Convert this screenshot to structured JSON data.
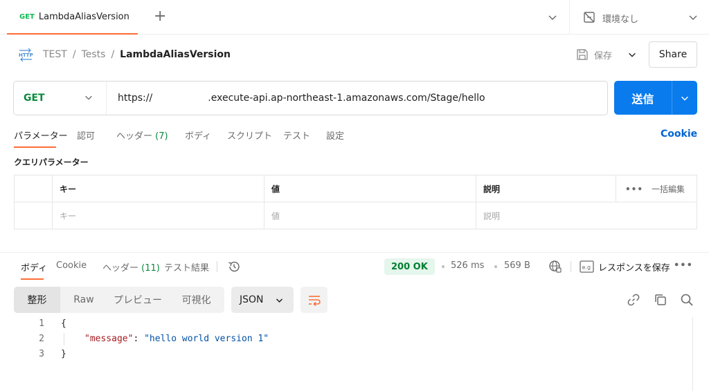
{
  "tab": {
    "method": "GET",
    "name": "LambdaAliasVersion",
    "new_tab": "+"
  },
  "environment": {
    "label": "環境なし"
  },
  "breadcrumb": {
    "items": [
      "TEST",
      "Tests"
    ],
    "current": "LambdaAliasVersion",
    "separator": "/"
  },
  "actions": {
    "save_label": "保存",
    "share_label": "Share"
  },
  "request": {
    "method": "GET",
    "url": "https://                  .execute-api.ap-northeast-1.amazonaws.com/Stage/hello",
    "send_label": "送信"
  },
  "request_tabs": [
    {
      "label": "パラメーター"
    },
    {
      "label": "認可"
    },
    {
      "label": "ヘッダー",
      "count": "(7)"
    },
    {
      "label": "ボディ"
    },
    {
      "label": "スクリプト"
    },
    {
      "label": "テスト"
    },
    {
      "label": "設定"
    }
  ],
  "cookie_link": "Cookie",
  "query_params": {
    "title": "クエリパラメーター",
    "headers": {
      "key": "キー",
      "value": "値",
      "description": "説明",
      "bulk_edit": "一括編集",
      "more": "•••"
    },
    "placeholders": {
      "key": "キー",
      "value": "値",
      "description": "説明"
    }
  },
  "response_tabs": [
    {
      "label": "ボディ"
    },
    {
      "label": "Cookie"
    },
    {
      "label": "ヘッダー",
      "count": "(11)"
    },
    {
      "label": "テスト結果"
    }
  ],
  "response_meta": {
    "status": "200 OK",
    "time": "526 ms",
    "size": "569 B",
    "save_label": "レスポンスを保存",
    "more": "•••",
    "status_color": "#007f31"
  },
  "format_tabs": [
    "整形",
    "Raw",
    "プレビュー",
    "可視化"
  ],
  "format_select": "JSON",
  "code_lines": [
    {
      "n": "1",
      "open": "{"
    },
    {
      "n": "2",
      "key": "\"message\"",
      "colon": ": ",
      "value": "\"hello world version 1\""
    },
    {
      "n": "3",
      "close": "}"
    }
  ],
  "colors": {
    "accent": "#ff6c37",
    "primary": "#097bed",
    "get": "#0a8a3c",
    "link": "#0265d2"
  },
  "icons": [
    "plus-icon",
    "chevron-down-icon",
    "no-environment-icon",
    "http-icon",
    "save-icon",
    "history-icon",
    "globe-icon",
    "example-icon",
    "wrap-lines-icon",
    "link-icon",
    "copy-icon",
    "search-icon"
  ]
}
